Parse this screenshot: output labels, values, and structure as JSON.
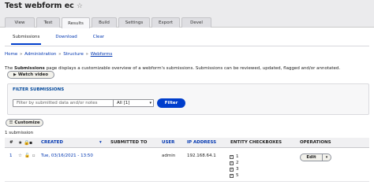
{
  "page": {
    "title": "Test webform ec",
    "star_icon": "☆"
  },
  "tabs": [
    {
      "label": "View"
    },
    {
      "label": "Test"
    },
    {
      "label": "Results",
      "active": true
    },
    {
      "label": "Build"
    },
    {
      "label": "Settings"
    },
    {
      "label": "Export"
    },
    {
      "label": "Devel"
    }
  ],
  "subtabs": [
    {
      "label": "Submissions",
      "active": true
    },
    {
      "label": "Download"
    },
    {
      "label": "Clear"
    }
  ],
  "breadcrumb": [
    "Home",
    "Administration",
    "Structure",
    "Webforms"
  ],
  "breadcrumb_sep": "»",
  "description": {
    "prefix": "The ",
    "strong": "Submissions",
    "rest": " page displays a customizable overview of a webform's submissions. Submissions can be reviewed, updated, flagged and/or annotated."
  },
  "watch_video": {
    "icon": "▶",
    "label": "Watch video"
  },
  "filter": {
    "heading": "FILTER SUBMISSIONS",
    "placeholder": "Filter by submitted data and/or notes",
    "state_value": "All [1]",
    "button": "Filter"
  },
  "customize": {
    "icon": "☰",
    "label": "Customize"
  },
  "submission_count": "1 submission",
  "table": {
    "headers": {
      "sid": "#",
      "created": "CREATED",
      "sort_icon": "▾",
      "submitted_to": "SUBMITTED TO",
      "user": "USER",
      "ip": "IP ADDRESS",
      "checkboxes": "ENTITY CHECKBOXES",
      "operations": "OPERATIONS"
    },
    "rows": [
      {
        "sid": "1",
        "created": "Tue, 03/16/2021 - 13:50",
        "submitted_to": "",
        "user": "admin",
        "ip": "192.168.64.1",
        "checkboxes": [
          "1",
          "2",
          "3",
          "5"
        ],
        "edit": "Edit"
      }
    ]
  },
  "colors": {
    "accent": "#003ecc",
    "link": "#0036b1"
  }
}
